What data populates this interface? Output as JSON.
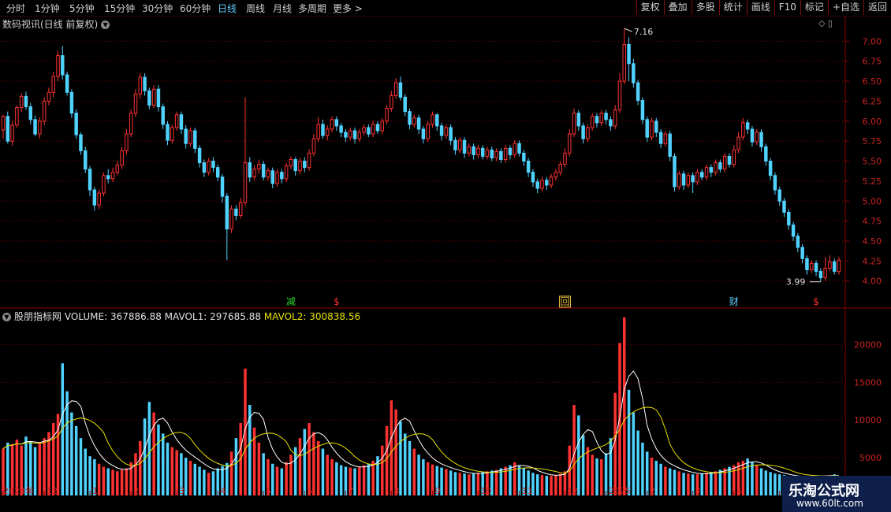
{
  "periods": [
    "分时",
    "1分钟",
    "5分钟",
    "15分钟",
    "30分钟",
    "60分钟",
    "日线",
    "周线",
    "月线",
    "多周期",
    "更多"
  ],
  "active_period": "日线",
  "more_arrow": ">",
  "toolbar": [
    "复权",
    "叠加",
    "多股",
    "统计",
    "画线",
    "F10",
    "标记",
    "+自选",
    "返回"
  ],
  "main_title": "数码视讯(日线 前复权)",
  "main_controls": "◇ ▯",
  "price_axis": [
    "7.00",
    "6.75",
    "6.50",
    "6.25",
    "6.00",
    "5.75",
    "5.50",
    "5.25",
    "5.00",
    "4.75",
    "4.50",
    "4.25",
    "4.00"
  ],
  "max_label": "7.16",
  "min_label": "3.99",
  "markers": [
    {
      "text": "减",
      "color": "#2bd92b"
    },
    {
      "text": "$",
      "color": "#ff3030"
    },
    {
      "text": "回",
      "color": "#e8c040"
    },
    {
      "text": "财",
      "color": "#5fd0ff"
    },
    {
      "text": "$",
      "color": "#ff3030"
    }
  ],
  "volume": {
    "name": "股朋指标网",
    "volume_label": "VOLUME: 367886.88",
    "mavol1_label": "MAVOL1: 297685.88",
    "mavol2_label": "MAVOL2: 300838.56",
    "axis": [
      "20000",
      "15000",
      "10000",
      "5000"
    ]
  },
  "date_axis": [
    "2024年",
    "12",
    "1",
    "2",
    "3",
    "4",
    "5",
    "6",
    "7",
    "8",
    "9",
    "10",
    "11",
    "12",
    "2025",
    "2",
    "3",
    "4",
    "5",
    "6"
  ],
  "watermark": {
    "title": "乐淘公式网",
    "url": "www.60lt.com"
  },
  "colors": {
    "up": "#ff3232",
    "down": "#50d2ff",
    "grid": "#8b0000",
    "ma1": "#ffffff",
    "ma2": "#e8e000"
  },
  "chart_data": {
    "type": "candlestick",
    "y_range": [
      3.8,
      7.25
    ],
    "candles": [
      [
        5.89,
        6.06,
        5.78,
        6.08
      ],
      [
        6.06,
        5.75,
        5.72,
        6.12
      ],
      [
        5.75,
        5.95,
        5.69,
        6.0
      ],
      [
        5.95,
        6.17,
        5.92,
        6.2
      ],
      [
        6.17,
        6.31,
        6.11,
        6.35
      ],
      [
        6.31,
        6.18,
        6.14,
        6.37
      ],
      [
        6.18,
        6.02,
        5.96,
        6.23
      ],
      [
        6.02,
        5.84,
        5.81,
        6.07
      ],
      [
        5.84,
        6.0,
        5.78,
        6.05
      ],
      [
        6.0,
        6.25,
        5.95,
        6.3
      ],
      [
        6.25,
        6.36,
        6.2,
        6.42
      ],
      [
        6.36,
        6.56,
        6.3,
        6.62
      ],
      [
        6.56,
        6.82,
        6.5,
        6.88
      ],
      [
        6.82,
        6.58,
        6.52,
        6.94
      ],
      [
        6.58,
        6.36,
        6.32,
        6.62
      ],
      [
        6.36,
        6.1,
        6.04,
        6.4
      ],
      [
        6.1,
        5.83,
        5.78,
        6.15
      ],
      [
        5.83,
        5.63,
        5.58,
        5.86
      ],
      [
        5.63,
        5.4,
        5.35,
        5.68
      ],
      [
        5.4,
        5.14,
        5.06,
        5.44
      ],
      [
        5.14,
        4.95,
        4.88,
        5.18
      ],
      [
        4.95,
        5.1,
        4.9,
        5.14
      ],
      [
        5.1,
        5.32,
        5.06,
        5.36
      ],
      [
        5.32,
        5.28,
        5.22,
        5.4
      ],
      [
        5.28,
        5.36,
        5.24,
        5.42
      ],
      [
        5.36,
        5.45,
        5.32,
        5.5
      ],
      [
        5.45,
        5.63,
        5.4,
        5.68
      ],
      [
        5.63,
        5.84,
        5.58,
        5.9
      ],
      [
        5.84,
        6.1,
        5.8,
        6.15
      ],
      [
        6.1,
        6.34,
        6.05,
        6.4
      ],
      [
        6.34,
        6.55,
        6.28,
        6.6
      ],
      [
        6.55,
        6.38,
        6.32,
        6.6
      ],
      [
        6.38,
        6.2,
        6.15,
        6.42
      ],
      [
        6.2,
        6.4,
        6.16,
        6.45
      ],
      [
        6.4,
        6.18,
        6.12,
        6.45
      ],
      [
        6.18,
        5.96,
        5.9,
        6.22
      ],
      [
        5.96,
        5.76,
        5.7,
        6.0
      ],
      [
        5.76,
        5.92,
        5.72,
        5.96
      ],
      [
        5.92,
        6.08,
        5.88,
        6.12
      ],
      [
        6.08,
        5.9,
        5.84,
        6.12
      ],
      [
        5.9,
        5.72,
        5.66,
        5.95
      ],
      [
        5.72,
        5.88,
        5.68,
        5.92
      ],
      [
        5.88,
        5.66,
        5.6,
        5.92
      ],
      [
        5.66,
        5.48,
        5.42,
        5.7
      ],
      [
        5.48,
        5.36,
        5.3,
        5.52
      ],
      [
        5.36,
        5.5,
        5.32,
        5.54
      ],
      [
        5.5,
        5.42,
        5.36,
        5.55
      ],
      [
        5.42,
        5.3,
        5.25,
        5.46
      ],
      [
        5.3,
        5.06,
        4.98,
        5.34
      ],
      [
        5.06,
        4.65,
        4.26,
        5.1
      ],
      [
        4.65,
        4.9,
        4.6,
        4.95
      ],
      [
        4.9,
        4.82,
        4.76,
        4.95
      ],
      [
        4.82,
        4.98,
        4.78,
        5.04
      ],
      [
        4.98,
        5.48,
        4.94,
        6.3
      ],
      [
        5.48,
        5.3,
        5.24,
        5.55
      ],
      [
        5.3,
        5.4,
        5.26,
        5.45
      ],
      [
        5.4,
        5.46,
        5.34,
        5.52
      ],
      [
        5.46,
        5.3,
        5.26,
        5.5
      ],
      [
        5.3,
        5.38,
        5.26,
        5.42
      ],
      [
        5.38,
        5.22,
        5.16,
        5.42
      ],
      [
        5.22,
        5.36,
        5.18,
        5.4
      ],
      [
        5.36,
        5.28,
        5.22,
        5.4
      ],
      [
        5.28,
        5.44,
        5.24,
        5.48
      ],
      [
        5.44,
        5.52,
        5.4,
        5.56
      ],
      [
        5.52,
        5.38,
        5.32,
        5.55
      ],
      [
        5.38,
        5.5,
        5.34,
        5.54
      ],
      [
        5.5,
        5.42,
        5.36,
        5.55
      ],
      [
        5.42,
        5.6,
        5.38,
        5.65
      ],
      [
        5.6,
        5.78,
        5.56,
        5.84
      ],
      [
        5.78,
        5.96,
        5.74,
        6.05
      ],
      [
        5.96,
        5.82,
        5.78,
        6.02
      ],
      [
        5.82,
        5.9,
        5.76,
        5.95
      ],
      [
        5.9,
        6.02,
        5.86,
        6.06
      ],
      [
        6.02,
        5.94,
        5.88,
        6.06
      ],
      [
        5.94,
        5.86,
        5.8,
        5.98
      ],
      [
        5.86,
        5.8,
        5.74,
        5.9
      ],
      [
        5.8,
        5.88,
        5.76,
        5.92
      ],
      [
        5.88,
        5.78,
        5.72,
        5.92
      ],
      [
        5.78,
        5.86,
        5.74,
        5.9
      ],
      [
        5.86,
        5.92,
        5.82,
        5.96
      ],
      [
        5.92,
        5.84,
        5.8,
        5.96
      ],
      [
        5.84,
        5.96,
        5.8,
        6.0
      ],
      [
        5.96,
        5.88,
        5.84,
        6.0
      ],
      [
        5.88,
        6.0,
        5.84,
        6.04
      ],
      [
        6.0,
        6.16,
        5.96,
        6.2
      ],
      [
        6.16,
        6.32,
        6.12,
        6.38
      ],
      [
        6.32,
        6.48,
        6.28,
        6.54
      ],
      [
        6.48,
        6.3,
        6.26,
        6.56
      ],
      [
        6.3,
        6.12,
        6.06,
        6.34
      ],
      [
        6.12,
        5.96,
        5.9,
        6.16
      ],
      [
        5.96,
        6.04,
        5.92,
        6.08
      ],
      [
        6.04,
        5.9,
        5.84,
        6.08
      ],
      [
        5.9,
        5.78,
        5.72,
        5.94
      ],
      [
        5.78,
        5.96,
        5.74,
        6.0
      ],
      [
        5.96,
        6.08,
        5.92,
        6.12
      ],
      [
        6.08,
        5.94,
        5.88,
        6.1
      ],
      [
        5.94,
        5.82,
        5.76,
        5.98
      ],
      [
        5.82,
        5.92,
        5.78,
        5.96
      ],
      [
        5.92,
        5.76,
        5.7,
        5.96
      ],
      [
        5.76,
        5.64,
        5.58,
        5.8
      ],
      [
        5.64,
        5.76,
        5.6,
        5.8
      ],
      [
        5.76,
        5.6,
        5.54,
        5.8
      ],
      [
        5.6,
        5.68,
        5.56,
        5.72
      ],
      [
        5.68,
        5.58,
        5.52,
        5.72
      ],
      [
        5.58,
        5.66,
        5.54,
        5.7
      ],
      [
        5.66,
        5.56,
        5.52,
        5.7
      ],
      [
        5.56,
        5.64,
        5.52,
        5.68
      ],
      [
        5.64,
        5.54,
        5.5,
        5.68
      ],
      [
        5.54,
        5.62,
        5.5,
        5.66
      ],
      [
        5.62,
        5.52,
        5.48,
        5.66
      ],
      [
        5.52,
        5.66,
        5.48,
        5.7
      ],
      [
        5.66,
        5.58,
        5.52,
        5.7
      ],
      [
        5.58,
        5.72,
        5.54,
        5.76
      ],
      [
        5.72,
        5.6,
        5.56,
        5.76
      ],
      [
        5.6,
        5.5,
        5.44,
        5.64
      ],
      [
        5.5,
        5.36,
        5.3,
        5.54
      ],
      [
        5.36,
        5.24,
        5.18,
        5.4
      ],
      [
        5.24,
        5.16,
        5.1,
        5.28
      ],
      [
        5.16,
        5.26,
        5.12,
        5.3
      ],
      [
        5.26,
        5.2,
        5.14,
        5.3
      ],
      [
        5.2,
        5.3,
        5.16,
        5.34
      ],
      [
        5.3,
        5.36,
        5.26,
        5.4
      ],
      [
        5.36,
        5.46,
        5.32,
        5.5
      ],
      [
        5.46,
        5.6,
        5.42,
        5.66
      ],
      [
        5.6,
        5.84,
        5.56,
        5.9
      ],
      [
        5.84,
        6.1,
        5.8,
        6.16
      ],
      [
        6.1,
        5.94,
        5.88,
        6.14
      ],
      [
        5.94,
        5.78,
        5.72,
        5.98
      ],
      [
        5.78,
        5.92,
        5.74,
        5.96
      ],
      [
        5.92,
        6.06,
        5.88,
        6.1
      ],
      [
        6.06,
        5.98,
        5.92,
        6.1
      ],
      [
        5.98,
        6.1,
        5.94,
        6.14
      ],
      [
        6.1,
        6.02,
        5.96,
        6.14
      ],
      [
        6.02,
        5.94,
        5.88,
        6.06
      ],
      [
        5.94,
        6.14,
        5.9,
        6.2
      ],
      [
        6.14,
        6.5,
        6.1,
        6.6
      ],
      [
        6.5,
        6.96,
        6.46,
        7.16
      ],
      [
        6.96,
        6.72,
        6.5,
        7.05
      ],
      [
        6.72,
        6.48,
        6.42,
        6.78
      ],
      [
        6.48,
        6.26,
        6.2,
        6.52
      ],
      [
        6.26,
        6.02,
        5.96,
        6.3
      ],
      [
        6.02,
        5.8,
        5.74,
        6.06
      ],
      [
        5.8,
        6.0,
        5.76,
        6.04
      ],
      [
        6.0,
        5.86,
        5.8,
        6.04
      ],
      [
        5.86,
        5.72,
        5.66,
        5.9
      ],
      [
        5.72,
        5.84,
        5.68,
        5.88
      ],
      [
        5.84,
        5.56,
        5.5,
        5.88
      ],
      [
        5.56,
        5.18,
        5.12,
        5.6
      ],
      [
        5.18,
        5.34,
        5.14,
        5.38
      ],
      [
        5.34,
        5.2,
        5.14,
        5.38
      ],
      [
        5.2,
        5.32,
        5.16,
        5.36
      ],
      [
        5.32,
        5.24,
        5.1,
        5.36
      ],
      [
        5.24,
        5.36,
        5.2,
        5.4
      ],
      [
        5.36,
        5.3,
        5.26,
        5.4
      ],
      [
        5.3,
        5.42,
        5.26,
        5.46
      ],
      [
        5.42,
        5.36,
        5.3,
        5.46
      ],
      [
        5.36,
        5.48,
        5.32,
        5.52
      ],
      [
        5.48,
        5.4,
        5.36,
        5.52
      ],
      [
        5.4,
        5.56,
        5.36,
        5.6
      ],
      [
        5.56,
        5.46,
        5.42,
        5.6
      ],
      [
        5.46,
        5.64,
        5.42,
        5.7
      ],
      [
        5.64,
        5.8,
        5.6,
        5.86
      ],
      [
        5.8,
        5.98,
        5.76,
        6.04
      ],
      [
        5.98,
        5.9,
        5.84,
        6.02
      ],
      [
        5.9,
        5.74,
        5.68,
        5.94
      ],
      [
        5.74,
        5.86,
        5.7,
        5.9
      ],
      [
        5.86,
        5.68,
        5.62,
        5.9
      ],
      [
        5.68,
        5.5,
        5.44,
        5.72
      ],
      [
        5.5,
        5.32,
        5.26,
        5.54
      ],
      [
        5.32,
        5.14,
        5.08,
        5.36
      ],
      [
        5.14,
        5.0,
        4.94,
        5.18
      ],
      [
        5.0,
        4.86,
        4.8,
        5.04
      ],
      [
        4.86,
        4.7,
        4.64,
        4.9
      ],
      [
        4.7,
        4.56,
        4.5,
        4.74
      ],
      [
        4.56,
        4.42,
        4.36,
        4.6
      ],
      [
        4.42,
        4.28,
        4.22,
        4.46
      ],
      [
        4.28,
        4.14,
        4.08,
        4.32
      ],
      [
        4.14,
        4.22,
        4.1,
        4.26
      ],
      [
        4.22,
        4.12,
        4.06,
        4.26
      ],
      [
        4.12,
        4.04,
        3.99,
        4.16
      ],
      [
        4.04,
        4.16,
        4.0,
        4.3
      ],
      [
        4.16,
        4.24,
        4.12,
        4.32
      ],
      [
        4.24,
        4.12,
        4.08,
        4.28
      ],
      [
        4.12,
        4.26,
        4.08,
        4.3
      ]
    ],
    "volumes": [
      6200,
      7000,
      6800,
      7400,
      6600,
      7800,
      7200,
      6400,
      7000,
      7600,
      8400,
      9600,
      10800,
      17500,
      13800,
      11000,
      9200,
      7600,
      6200,
      5200,
      4800,
      4200,
      3800,
      3600,
      3400,
      3200,
      3400,
      3600,
      4400,
      5600,
      7200,
      10200,
      12400,
      11000,
      9400,
      8200,
      7000,
      6400,
      6000,
      5600,
      5000,
      4600,
      4200,
      3800,
      3400,
      3000,
      3200,
      3600,
      3900,
      4300,
      5800,
      7600,
      9600,
      16800,
      12000,
      9000,
      7000,
      5600,
      4800,
      4200,
      3800,
      3600,
      4400,
      5400,
      6400,
      7600,
      8800,
      9600,
      8400,
      7200,
      6200,
      5400,
      4800,
      4400,
      4000,
      3800,
      3700,
      3600,
      3800,
      4000,
      4200,
      4600,
      5200,
      6600,
      9200,
      12600,
      11400,
      9800,
      8200,
      7200,
      6200,
      5400,
      4800,
      4400,
      4100,
      3900,
      3700,
      3500,
      3300,
      3100,
      3000,
      2900,
      2800,
      2900,
      3000,
      3100,
      3200,
      3300,
      3400,
      3600,
      3800,
      4000,
      4400,
      4000,
      3600,
      3300,
      3000,
      2800,
      2700,
      2600,
      2600,
      2700,
      2900,
      3200,
      6600,
      12000,
      10600,
      8000,
      6400,
      5400,
      4900,
      4800,
      5600,
      7600,
      13600,
      20200,
      23600,
      14000,
      11000,
      8600,
      7000,
      5800,
      5000,
      4600,
      4200,
      3800,
      3600,
      3400,
      3200,
      3000,
      2900,
      2800,
      2800,
      2900,
      3000,
      3100,
      3200,
      3400,
      3600,
      3800,
      4000,
      4400,
      4600,
      4900,
      4400,
      4000,
      3600,
      3300,
      3100,
      2900,
      2800,
      2700,
      2600,
      2500,
      2400,
      2500,
      2600,
      2700,
      2600,
      2500,
      2600,
      2700,
      2800,
      2600
    ],
    "volume_range": [
      0,
      24000
    ],
    "date_ticks": [
      "2024年",
      "12",
      "1",
      "2",
      "3",
      "4",
      "5",
      "6",
      "7",
      "8",
      "9",
      "10",
      "11",
      "12",
      "2025",
      "2",
      "3",
      "4",
      "5",
      "6"
    ]
  }
}
